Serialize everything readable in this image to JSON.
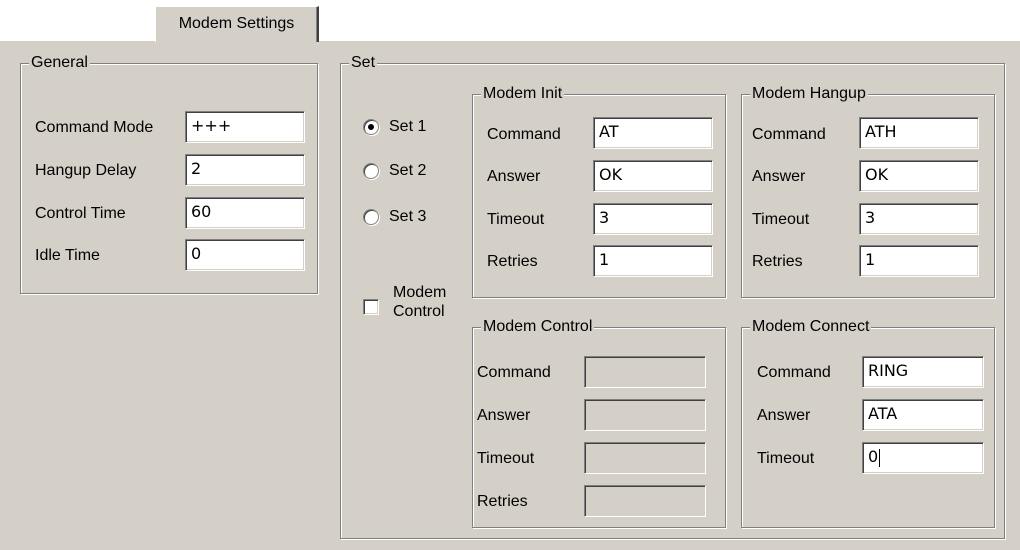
{
  "tab": {
    "label": "Modem Settings"
  },
  "general": {
    "legend": "General",
    "fields": [
      {
        "label": "Command Mode",
        "value": "+++"
      },
      {
        "label": "Hangup Delay",
        "value": "2"
      },
      {
        "label": "Control Time",
        "value": "60"
      },
      {
        "label": "Idle Time",
        "value": "0"
      }
    ]
  },
  "set": {
    "legend": "Set",
    "options": [
      "Set 1",
      "Set 2",
      "Set 3"
    ],
    "selected": "Set 1",
    "modem_control_checkbox": {
      "line1": "Modem",
      "line2": "Control",
      "checked": false
    }
  },
  "modem_init": {
    "legend": "Modem Init",
    "fields": [
      {
        "label": "Command",
        "value": "AT"
      },
      {
        "label": "Answer",
        "value": "OK"
      },
      {
        "label": "Timeout",
        "value": "3"
      },
      {
        "label": "Retries",
        "value": "1"
      }
    ]
  },
  "modem_hangup": {
    "legend": "Modem Hangup",
    "fields": [
      {
        "label": "Command",
        "value": "ATH"
      },
      {
        "label": "Answer",
        "value": "OK"
      },
      {
        "label": "Timeout",
        "value": "3"
      },
      {
        "label": "Retries",
        "value": "1"
      }
    ]
  },
  "modem_control": {
    "legend": "Modem Control",
    "fields": [
      {
        "label": "Command",
        "value": ""
      },
      {
        "label": "Answer",
        "value": ""
      },
      {
        "label": "Timeout",
        "value": ""
      },
      {
        "label": "Retries",
        "value": ""
      }
    ]
  },
  "modem_connect": {
    "legend": "Modem Connect",
    "fields": [
      {
        "label": "Command",
        "value": "RING"
      },
      {
        "label": "Answer",
        "value": "ATA"
      },
      {
        "label": "Timeout",
        "value": "0"
      }
    ]
  }
}
